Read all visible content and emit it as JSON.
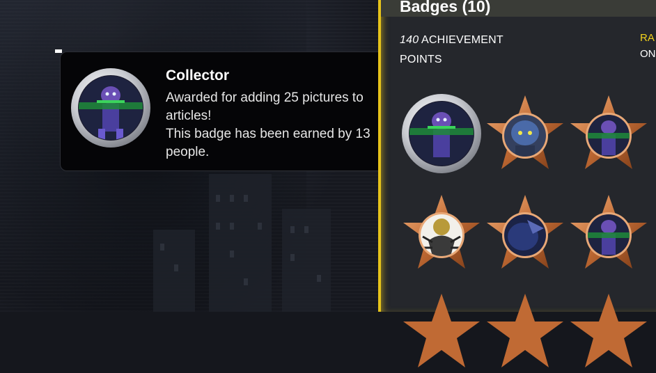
{
  "tooltip": {
    "title": "Collector",
    "description_line1": "Awarded for adding 25 pictures to articles!",
    "description_line2": "This badge has been earned by 13 people."
  },
  "panel": {
    "title": "Badges (10)",
    "points_value": "140",
    "points_label": " ACHIEVEMENT POINTS",
    "rank_label": "RA",
    "rank_value": "ON"
  },
  "badges": [
    {
      "name": "Collector",
      "style": "silver"
    },
    {
      "name": "badge-2",
      "style": "bronze-star"
    },
    {
      "name": "badge-3",
      "style": "bronze-star"
    },
    {
      "name": "badge-4",
      "style": "bronze-star"
    },
    {
      "name": "badge-5",
      "style": "bronze-star"
    },
    {
      "name": "badge-6",
      "style": "bronze-star"
    }
  ],
  "colors": {
    "accent": "#e6c31a",
    "panel_bg": "#25272c",
    "tooltip_bg": "#050507"
  }
}
